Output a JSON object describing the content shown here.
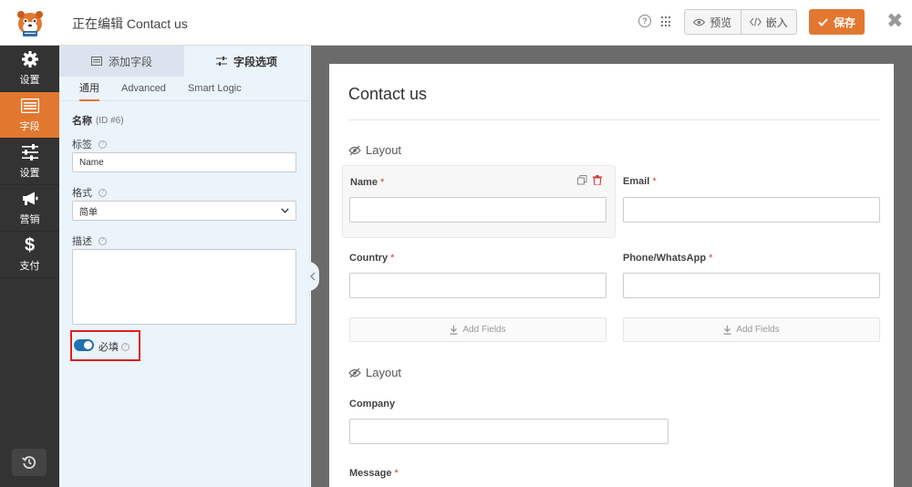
{
  "header": {
    "title": "正在编辑 Contact us",
    "help": "?",
    "preview_label": "预览",
    "embed_label": "嵌入",
    "save_label": "保存",
    "close": "✖"
  },
  "sidenav": {
    "items": [
      {
        "label": "设置",
        "icon": "gear-icon"
      },
      {
        "label": "字段",
        "icon": "fields-icon",
        "active": true
      },
      {
        "label": "设置",
        "icon": "sliders-icon"
      },
      {
        "label": "营销",
        "icon": "megaphone-icon"
      },
      {
        "label": "支付",
        "icon": "dollar-icon"
      }
    ],
    "history_icon": "history-icon"
  },
  "panel": {
    "tabs": [
      {
        "label": "添加字段",
        "active": false
      },
      {
        "label": "字段选项",
        "active": true
      }
    ],
    "subtabs": [
      "通用",
      "Advanced",
      "Smart Logic"
    ],
    "field_name": "名称",
    "field_id": "(ID #6)",
    "label_title": "标签",
    "label_value": "Name",
    "format_title": "格式",
    "format_value": "简单",
    "description_title": "描述",
    "description_value": "",
    "required_label": "必填",
    "required_on": true,
    "help": "?"
  },
  "form": {
    "title": "Contact us",
    "layout_label": "Layout",
    "fields": {
      "name": {
        "label": "Name",
        "required": "*"
      },
      "email": {
        "label": "Email",
        "required": "*"
      },
      "country": {
        "label": "Country",
        "required": "*"
      },
      "phone": {
        "label": "Phone/WhatsApp",
        "required": "*"
      },
      "company": {
        "label": "Company"
      },
      "message": {
        "label": "Message",
        "required": "*"
      }
    },
    "add_fields_label": "Add Fields"
  },
  "colors": {
    "accent": "#e27730",
    "nav_bg": "#333333",
    "panel_bg": "#ebf3fb",
    "toggle": "#2271b1",
    "required_star": "#d63638",
    "highlight_box": "#e02020"
  }
}
